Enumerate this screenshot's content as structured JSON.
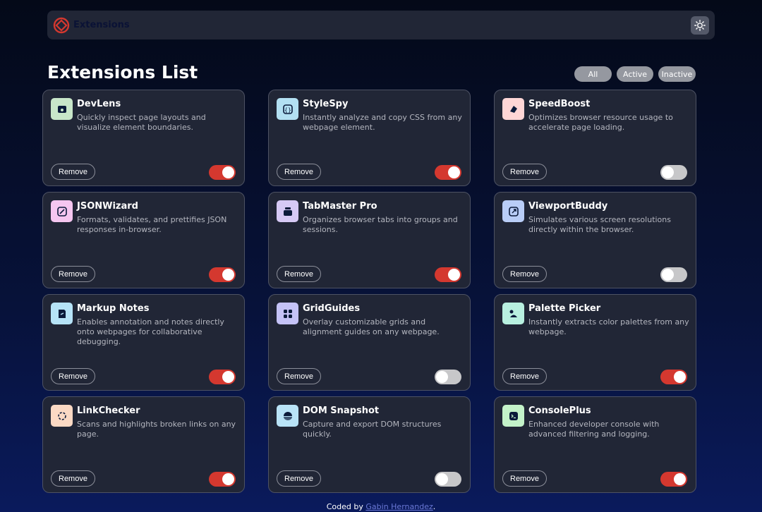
{
  "header": {
    "logo_text": "Extensions",
    "theme_icon": "sun-icon"
  },
  "page": {
    "title": "Extensions List"
  },
  "filters": {
    "all": "All",
    "active": "Active",
    "inactive": "Inactive"
  },
  "remove_label": "Remove",
  "extensions": [
    {
      "name": "DevLens",
      "description": "Quickly inspect page layouts and visualize element boundaries.",
      "active": true,
      "icon": "devlens-icon",
      "icon_bg": "#c8e6c9"
    },
    {
      "name": "StyleSpy",
      "description": "Instantly analyze and copy CSS from any webpage element.",
      "active": true,
      "icon": "stylespy-icon",
      "icon_bg": "#b3e0f2"
    },
    {
      "name": "SpeedBoost",
      "description": "Optimizes browser resource usage to accelerate page loading.",
      "active": false,
      "icon": "speedboost-icon",
      "icon_bg": "#ffd6d6"
    },
    {
      "name": "JSONWizard",
      "description": "Formats, validates, and prettifies JSON responses in-browser.",
      "active": true,
      "icon": "jsonwizard-icon",
      "icon_bg": "#f5c6f0"
    },
    {
      "name": "TabMaster Pro",
      "description": "Organizes browser tabs into groups and sessions.",
      "active": true,
      "icon": "tabmaster-icon",
      "icon_bg": "#d6c9f5"
    },
    {
      "name": "ViewportBuddy",
      "description": "Simulates various screen resolutions directly within the browser.",
      "active": false,
      "icon": "viewportbuddy-icon",
      "icon_bg": "#b9cdf7"
    },
    {
      "name": "Markup Notes",
      "description": "Enables annotation and notes directly onto webpages for collaborative debugging.",
      "active": true,
      "icon": "markupnotes-icon",
      "icon_bg": "#b6e3f7"
    },
    {
      "name": "GridGuides",
      "description": "Overlay customizable grids and alignment guides on any webpage.",
      "active": false,
      "icon": "gridguides-icon",
      "icon_bg": "#c5c3f7"
    },
    {
      "name": "Palette Picker",
      "description": "Instantly extracts color palettes from any webpage.",
      "active": true,
      "icon": "palettepicker-icon",
      "icon_bg": "#b8f0e0"
    },
    {
      "name": "LinkChecker",
      "description": "Scans and highlights broken links on any page.",
      "active": true,
      "icon": "linkchecker-icon",
      "icon_bg": "#fbd9c4"
    },
    {
      "name": "DOM Snapshot",
      "description": "Capture and export DOM structures quickly.",
      "active": false,
      "icon": "domsnapshot-icon",
      "icon_bg": "#b9e3f7"
    },
    {
      "name": "ConsolePlus",
      "description": "Enhanced developer console with advanced filtering and logging.",
      "active": true,
      "icon": "consoleplus-icon",
      "icon_bg": "#c3f2c9"
    }
  ],
  "footer": {
    "prefix": "Coded by",
    "author": "Gabin Hernandez",
    "suffix": "."
  },
  "colors": {
    "accent": "#d4382f",
    "card_bg": "#212636",
    "toggle_off": "#c7c7c9"
  }
}
